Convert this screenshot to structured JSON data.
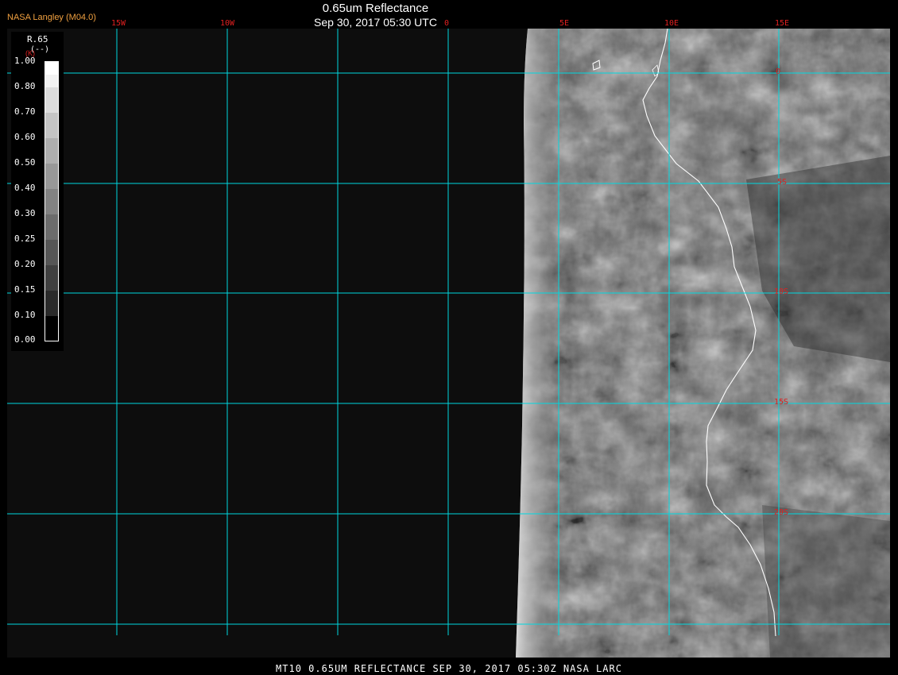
{
  "header": {
    "agency": "NASA Langley (M04.0)",
    "title": "0.65um Reflectance",
    "subtitle": "Sep 30, 2017 05:30 UTC"
  },
  "footer": {
    "text": "MT10  0.65UM REFLECTANCE   SEP 30, 2017 05:30Z   NASA LARC"
  },
  "legend": {
    "title": "R.65",
    "unit": "(--)",
    "k_label": "(K)",
    "ticks": [
      "1.00",
      "0.80",
      "0.70",
      "0.60",
      "0.50",
      "0.40",
      "0.30",
      "0.25",
      "0.20",
      "0.15",
      "0.10",
      "0.00"
    ]
  },
  "map": {
    "lon_labels": [
      "15W",
      "10W",
      "0",
      "5E",
      "10E",
      "15E"
    ],
    "lat_labels": [
      "0",
      "5S",
      "10S",
      "15S",
      "20S"
    ]
  },
  "colors": {
    "grid": "#00d8e0",
    "label": "#e02020",
    "agency": "#f0a040",
    "coast": "#ffffff"
  }
}
